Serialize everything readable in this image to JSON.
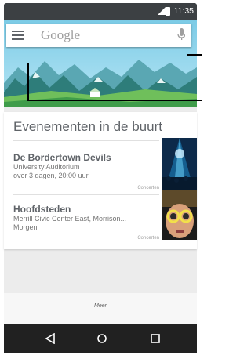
{
  "status_bar": {
    "time": "11:35"
  },
  "search": {
    "placeholder": "Google"
  },
  "card": {
    "title": "Evenementen in de buurt",
    "events": [
      {
        "name": "De Bordertown Devils",
        "venue": "University Auditorium",
        "when": "over 3 dagen, 20:00 uur",
        "category": "Concerten"
      },
      {
        "name": "Hoofdsteden",
        "venue": "Merrill Civic Center East, Morrison...",
        "when": "Morgen",
        "category": "Concerten"
      }
    ]
  },
  "more": {
    "label": "Meer"
  },
  "colors": {
    "status_bar": "#3c4043",
    "nav_bar": "#212121",
    "sky": "#8fd3ee",
    "mountain": "#2e7d7a"
  }
}
